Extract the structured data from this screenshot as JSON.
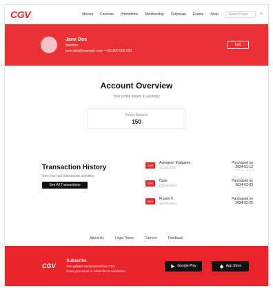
{
  "nav": {
    "logo": "CGV",
    "links": [
      "Movies",
      "Cinemas",
      "Promotions",
      "Membership",
      "Corporate",
      "Events",
      "Shop"
    ],
    "search_placeholder": "Search here",
    "close_symbol": "×"
  },
  "hero": {
    "name": "Jane Doe",
    "line2": "Member",
    "line3": "jane.doe@example.com • +62 800 000 000",
    "edit_label": "Edit"
  },
  "overview": {
    "title": "Account Overview",
    "subtitle": "Your profile details & summary",
    "stat_label": "Points Balance",
    "stat_value": "150"
  },
  "transactions": {
    "title": "Transaction History",
    "desc": "See your last transaction activities",
    "button": "See All Transactions",
    "items": [
      {
        "icon": "CGV",
        "name": "Avengers: Endgame",
        "date": "12 Jan 2024",
        "status": "Purchased on",
        "status_date": "2024-01-12"
      },
      {
        "icon": "CGV",
        "name": "Dune",
        "date": "03 Feb 2024",
        "status": "Purchased on",
        "status_date": "2024-02-03"
      },
      {
        "icon": "CGV",
        "name": "Frozen II",
        "date": "25 Feb 2024",
        "status": "Purchased on",
        "status_date": "2024-02-25"
      }
    ]
  },
  "footer_links": [
    "About Us",
    "Legal Terms",
    "Careers",
    "Feedback"
  ],
  "footer": {
    "logo": "CGV",
    "heading": "Subscribe",
    "line1": "Get updates and promos from CGV",
    "line2": "Enter your email to subscribe to newsletter",
    "google_play": "Google Play",
    "app_store": "App Store"
  },
  "colors": {
    "brand_red": "#e9252b",
    "hero_red": "#ea3136",
    "dark": "#111111"
  }
}
